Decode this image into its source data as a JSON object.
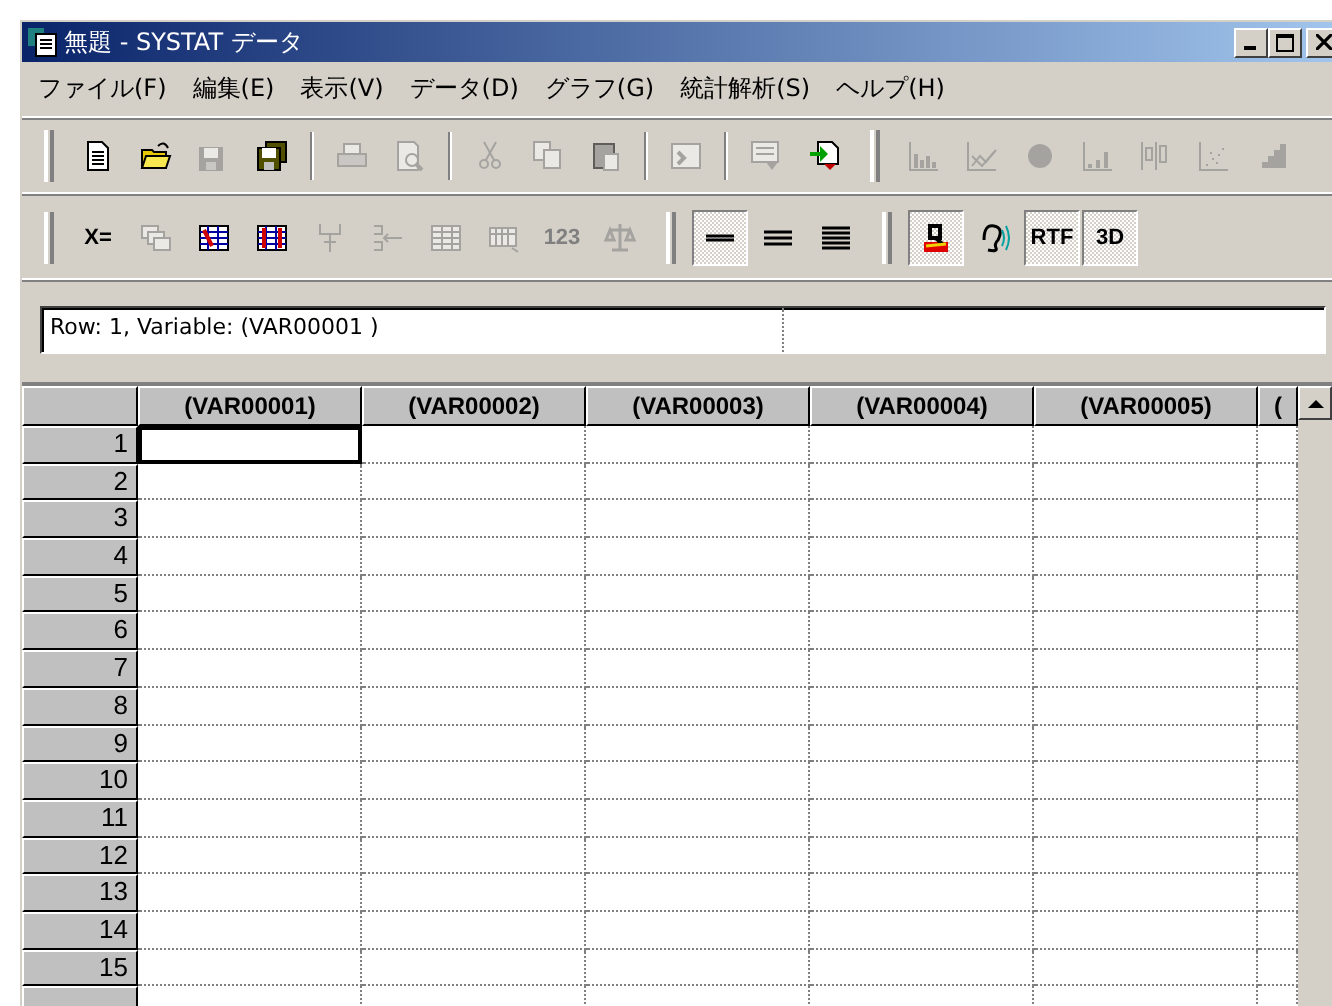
{
  "window": {
    "title": "無題 - SYSTAT データ"
  },
  "menu": [
    {
      "label": "ファイル(F)"
    },
    {
      "label": "編集(E)"
    },
    {
      "label": "表示(V)"
    },
    {
      "label": "データ(D)"
    },
    {
      "label": "グラフ(G)"
    },
    {
      "label": "統計解析(S)"
    },
    {
      "label": "ヘルプ(H)"
    }
  ],
  "toolbars": [
    {
      "items": [
        {
          "kind": "grip"
        },
        {
          "kind": "icon",
          "disabled": false,
          "pressed": false
        },
        {
          "kind": "icon",
          "disabled": false,
          "pressed": false
        },
        {
          "kind": "icon",
          "disabled": true,
          "pressed": false
        },
        {
          "kind": "icon",
          "disabled": false,
          "pressed": false
        },
        {
          "kind": "separator"
        },
        {
          "kind": "icon",
          "disabled": true,
          "pressed": false
        },
        {
          "kind": "icon",
          "disabled": true,
          "pressed": false
        },
        {
          "kind": "separator"
        },
        {
          "kind": "icon",
          "disabled": true,
          "pressed": false
        },
        {
          "kind": "icon",
          "disabled": true,
          "pressed": false
        },
        {
          "kind": "icon",
          "disabled": true,
          "pressed": false
        },
        {
          "kind": "separator"
        },
        {
          "kind": "icon",
          "disabled": true,
          "pressed": false
        },
        {
          "kind": "separator"
        },
        {
          "kind": "icon",
          "disabled": true,
          "pressed": false
        },
        {
          "kind": "icon",
          "disabled": false,
          "pressed": false
        },
        {
          "kind": "grip"
        },
        {
          "kind": "icon",
          "disabled": true,
          "pressed": false
        },
        {
          "kind": "icon",
          "disabled": true,
          "pressed": false
        },
        {
          "kind": "icon",
          "disabled": true,
          "pressed": false
        },
        {
          "kind": "icon",
          "disabled": true,
          "pressed": false
        },
        {
          "kind": "icon",
          "disabled": true,
          "pressed": false
        },
        {
          "kind": "icon",
          "disabled": true,
          "pressed": false
        },
        {
          "kind": "icon",
          "disabled": true,
          "pressed": false
        }
      ]
    },
    {
      "items": [
        {
          "kind": "grip"
        },
        {
          "kind": "text",
          "label": "X=",
          "disabled": false,
          "pressed": false
        },
        {
          "kind": "icon",
          "disabled": true,
          "pressed": false
        },
        {
          "kind": "icon",
          "disabled": false,
          "pressed": false
        },
        {
          "kind": "icon",
          "disabled": false,
          "pressed": false
        },
        {
          "kind": "icon",
          "disabled": true,
          "pressed": false
        },
        {
          "kind": "icon",
          "disabled": true,
          "pressed": false
        },
        {
          "kind": "icon",
          "disabled": true,
          "pressed": false
        },
        {
          "kind": "icon",
          "disabled": true,
          "pressed": false
        },
        {
          "kind": "text",
          "label": "123",
          "disabled": true,
          "pressed": false
        },
        {
          "kind": "icon",
          "disabled": true,
          "pressed": false
        },
        {
          "kind": "grip"
        },
        {
          "kind": "icon",
          "disabled": false,
          "pressed": true
        },
        {
          "kind": "icon",
          "disabled": false,
          "pressed": false
        },
        {
          "kind": "icon",
          "disabled": false,
          "pressed": false
        },
        {
          "kind": "grip"
        },
        {
          "kind": "icon",
          "disabled": false,
          "pressed": true
        },
        {
          "kind": "icon",
          "disabled": false,
          "pressed": false
        },
        {
          "kind": "text",
          "label": "RTF",
          "disabled": false,
          "pressed": true
        },
        {
          "kind": "text",
          "label": "3D",
          "disabled": false,
          "pressed": true
        }
      ]
    }
  ],
  "status_field": {
    "value": "Row: 1,  Variable: (VAR00001 )"
  },
  "grid": {
    "columns": [
      {
        "label": "(VAR00001)"
      },
      {
        "label": "(VAR00002)"
      },
      {
        "label": "(VAR00003)"
      },
      {
        "label": "(VAR00004)"
      },
      {
        "label": "(VAR00005)"
      },
      {
        "label": "("
      }
    ],
    "rows": [
      {
        "label": "1",
        "cells": [
          {
            "selected": true
          },
          {
            "selected": false
          },
          {
            "selected": false
          },
          {
            "selected": false
          },
          {
            "selected": false
          },
          {
            "selected": false
          }
        ]
      },
      {
        "label": "2",
        "cells": [
          {
            "selected": false
          },
          {
            "selected": false
          },
          {
            "selected": false
          },
          {
            "selected": false
          },
          {
            "selected": false
          },
          {
            "selected": false
          }
        ]
      },
      {
        "label": "3",
        "cells": [
          {
            "selected": false
          },
          {
            "selected": false
          },
          {
            "selected": false
          },
          {
            "selected": false
          },
          {
            "selected": false
          },
          {
            "selected": false
          }
        ]
      },
      {
        "label": "4",
        "cells": [
          {
            "selected": false
          },
          {
            "selected": false
          },
          {
            "selected": false
          },
          {
            "selected": false
          },
          {
            "selected": false
          },
          {
            "selected": false
          }
        ]
      },
      {
        "label": "5",
        "cells": [
          {
            "selected": false
          },
          {
            "selected": false
          },
          {
            "selected": false
          },
          {
            "selected": false
          },
          {
            "selected": false
          },
          {
            "selected": false
          }
        ]
      },
      {
        "label": "6",
        "cells": [
          {
            "selected": false
          },
          {
            "selected": false
          },
          {
            "selected": false
          },
          {
            "selected": false
          },
          {
            "selected": false
          },
          {
            "selected": false
          }
        ]
      },
      {
        "label": "7",
        "cells": [
          {
            "selected": false
          },
          {
            "selected": false
          },
          {
            "selected": false
          },
          {
            "selected": false
          },
          {
            "selected": false
          },
          {
            "selected": false
          }
        ]
      },
      {
        "label": "8",
        "cells": [
          {
            "selected": false
          },
          {
            "selected": false
          },
          {
            "selected": false
          },
          {
            "selected": false
          },
          {
            "selected": false
          },
          {
            "selected": false
          }
        ]
      },
      {
        "label": "9",
        "cells": [
          {
            "selected": false
          },
          {
            "selected": false
          },
          {
            "selected": false
          },
          {
            "selected": false
          },
          {
            "selected": false
          },
          {
            "selected": false
          }
        ]
      },
      {
        "label": "10",
        "cells": [
          {
            "selected": false
          },
          {
            "selected": false
          },
          {
            "selected": false
          },
          {
            "selected": false
          },
          {
            "selected": false
          },
          {
            "selected": false
          }
        ]
      },
      {
        "label": "11",
        "cells": [
          {
            "selected": false
          },
          {
            "selected": false
          },
          {
            "selected": false
          },
          {
            "selected": false
          },
          {
            "selected": false
          },
          {
            "selected": false
          }
        ]
      },
      {
        "label": "12",
        "cells": [
          {
            "selected": false
          },
          {
            "selected": false
          },
          {
            "selected": false
          },
          {
            "selected": false
          },
          {
            "selected": false
          },
          {
            "selected": false
          }
        ]
      },
      {
        "label": "13",
        "cells": [
          {
            "selected": false
          },
          {
            "selected": false
          },
          {
            "selected": false
          },
          {
            "selected": false
          },
          {
            "selected": false
          },
          {
            "selected": false
          }
        ]
      },
      {
        "label": "14",
        "cells": [
          {
            "selected": false
          },
          {
            "selected": false
          },
          {
            "selected": false
          },
          {
            "selected": false
          },
          {
            "selected": false
          },
          {
            "selected": false
          }
        ]
      },
      {
        "label": "15",
        "cells": [
          {
            "selected": false
          },
          {
            "selected": false
          },
          {
            "selected": false
          },
          {
            "selected": false
          },
          {
            "selected": false
          },
          {
            "selected": false
          }
        ]
      }
    ]
  }
}
